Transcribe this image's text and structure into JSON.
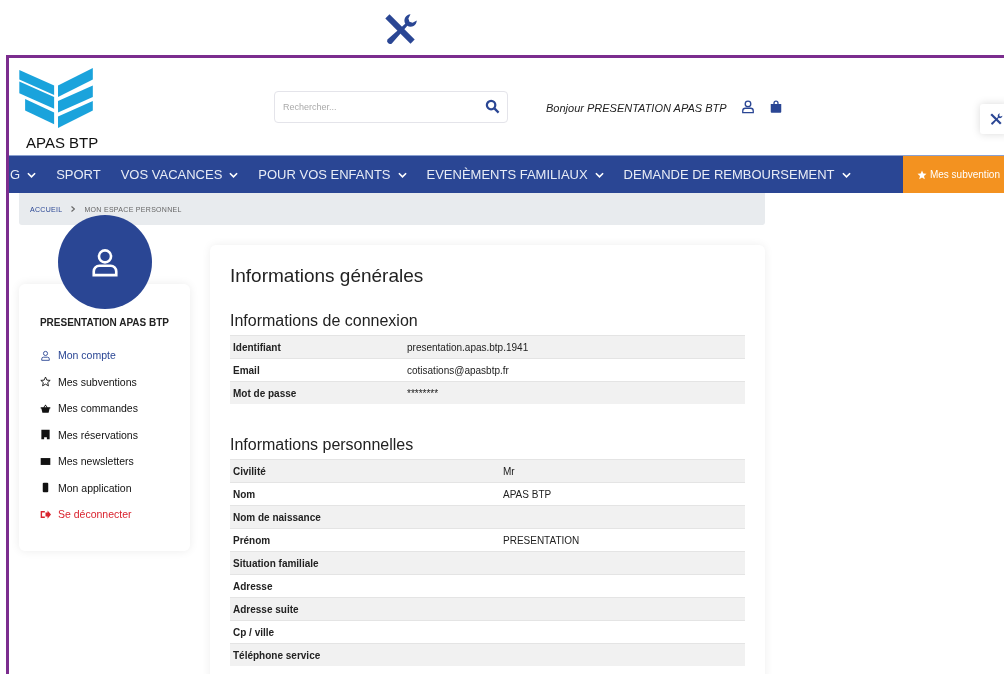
{
  "header": {
    "logo_text": "APAS BTP",
    "search": {
      "placeholder": "Rechercher..."
    },
    "greeting": "Bonjour PRESENTATION APAS BTP"
  },
  "nav": {
    "items": [
      {
        "label": "G",
        "dropdown": true
      },
      {
        "label": "SPORT",
        "dropdown": false
      },
      {
        "label": "VOS VACANCES",
        "dropdown": true
      },
      {
        "label": "POUR VOS ENFANTS",
        "dropdown": true
      },
      {
        "label": "EVENÈMENTS FAMILIAUX",
        "dropdown": true
      },
      {
        "label": "DEMANDE DE REMBOURSEMENT",
        "dropdown": true
      }
    ],
    "cta": "Mes subvention"
  },
  "breadcrumb": [
    {
      "label": "ACCUEIL",
      "kind": "link"
    },
    {
      "label": "MON ESPACE PERSONNEL",
      "kind": "current"
    }
  ],
  "sidebar": {
    "user_name": "PRESENTATION APAS BTP",
    "items": [
      {
        "label": "Mon compte",
        "selected": true,
        "kind": "link"
      },
      {
        "label": "Mes subventions",
        "selected": false,
        "kind": "link"
      },
      {
        "label": "Mes commandes",
        "selected": false,
        "kind": "link"
      },
      {
        "label": "Mes réservations",
        "selected": false,
        "kind": "link"
      },
      {
        "label": "Mes newsletters",
        "selected": false,
        "kind": "link"
      },
      {
        "label": "Mon application",
        "selected": false,
        "kind": "link"
      },
      {
        "label": "Se déconnecter",
        "selected": false,
        "kind": "logout"
      }
    ]
  },
  "main": {
    "title": "Informations générales",
    "sections": [
      {
        "title": "Informations de connexion",
        "rows": [
          {
            "label": "Identifiant",
            "value": "presentation.apas.btp.1941"
          },
          {
            "label": "Email",
            "value": "cotisations@apasbtp.fr"
          },
          {
            "label": "Mot de passe",
            "value": "********"
          }
        ]
      },
      {
        "title": "Informations personnelles",
        "rows": [
          {
            "label": "Civilité",
            "value": "Mr"
          },
          {
            "label": "Nom",
            "value": "APAS BTP"
          },
          {
            "label": "Nom de naissance"
          },
          {
            "label": "Prénom",
            "value": "PRESENTATION"
          },
          {
            "label": "Situation familiale"
          },
          {
            "label": "Adresse"
          },
          {
            "label": "Adresse suite"
          },
          {
            "label": "Cp / ville"
          },
          {
            "label": "Téléphone service"
          }
        ]
      }
    ]
  }
}
